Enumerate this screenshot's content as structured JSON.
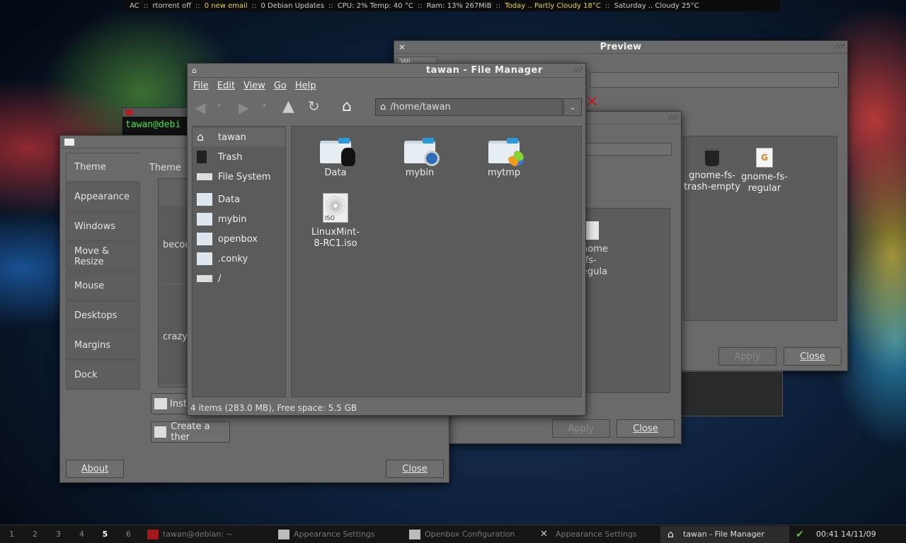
{
  "topbar": {
    "ac": "AC",
    "rtorrent": "rtorrent off",
    "email": "0 new email",
    "updates": "0 Debian Updates",
    "cpu": "CPU: 2%  Temp: 40 °C",
    "ram": "Ram: 13%  267MiB",
    "today": "Today .. Partly Cloudy 18°C",
    "saturday": "Saturday .. Cloudy 25°C",
    "sep": "::"
  },
  "terminal": {
    "prompt": "tawan@debi"
  },
  "preview": {
    "title": "Preview",
    "tab1": "Wi",
    "apply": "Apply",
    "close": "Close",
    "icons": [
      {
        "label": "gnome-fs-trash-empty"
      },
      {
        "label": "gnome-fs-regular"
      }
    ]
  },
  "middle": {
    "apply": "Apply",
    "close": "Close",
    "partial_label": "nome-fs-egular"
  },
  "appearance": {
    "tabs": [
      "Theme",
      "Appearance",
      "Windows",
      "Move & Resize",
      "Mouse",
      "Desktops",
      "Margins",
      "Dock"
    ],
    "header": "Theme",
    "theme1": "becon",
    "theme2": "crazy",
    "install": "Insta",
    "create": "Create a ther",
    "about": "About",
    "close": "Close"
  },
  "fm": {
    "title": "tawan - File Manager",
    "menu": [
      "File",
      "Edit",
      "View",
      "Go",
      "Help"
    ],
    "location": "/home/tawan",
    "sidebar": [
      {
        "label": "tawan"
      },
      {
        "label": "Trash"
      },
      {
        "label": "File System"
      },
      {
        "label": "Data"
      },
      {
        "label": "mybin"
      },
      {
        "label": "openbox"
      },
      {
        "label": ".conky"
      },
      {
        "label": "/"
      }
    ],
    "files": [
      {
        "label": "Data"
      },
      {
        "label": "mybin"
      },
      {
        "label": "mytmp"
      },
      {
        "label": "LinuxMint-8-RC1.iso"
      }
    ],
    "status": "4 items (283.0 MB), Free space: 5.5 GB"
  },
  "taskbar": {
    "workspaces": [
      "1",
      "2",
      "3",
      "4",
      "5",
      "6"
    ],
    "current": "5",
    "tasks": [
      {
        "label": "tawan@debian: ~"
      },
      {
        "label": "Appearance Settings"
      },
      {
        "label": "Openbox Configuration"
      },
      {
        "label": "Appearance Settings"
      },
      {
        "label": "tawan - File Manager"
      }
    ],
    "clock": "00:41 14/11/09"
  }
}
